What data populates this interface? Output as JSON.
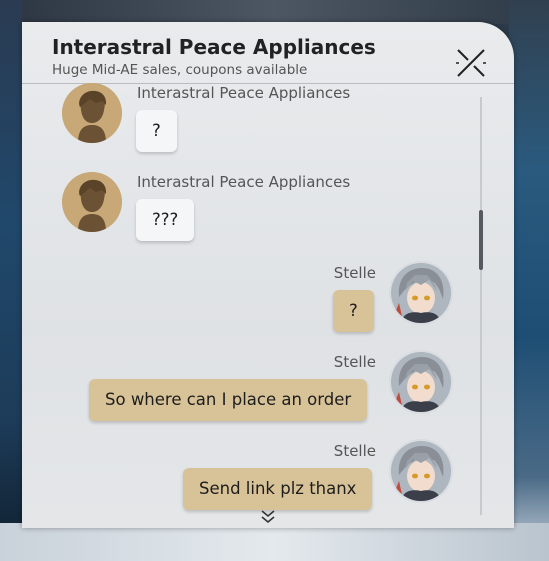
{
  "header": {
    "title": "Interastral Peace Appliances",
    "subtitle": "Huge Mid-AE sales, coupons available"
  },
  "messages": [
    {
      "sender": "Interastral Peace Appliances",
      "side": "left",
      "text": "?"
    },
    {
      "sender": "Interastral Peace Appliances",
      "side": "left",
      "text": "???"
    },
    {
      "sender": "Stelle",
      "side": "right",
      "text": "?"
    },
    {
      "sender": "Stelle",
      "side": "right",
      "text": "So where can I place an order"
    },
    {
      "sender": "Stelle",
      "side": "right",
      "text": "Send link plz thanx"
    }
  ],
  "icons": {
    "close": "close-icon",
    "scroll_more": "chevron-double-down-icon"
  },
  "colors": {
    "panel_bg": "#e4e6e8",
    "incoming_bubble": "#f5f6f7",
    "outgoing_bubble": "#d8c297",
    "shop_avatar": "#c8a877"
  }
}
